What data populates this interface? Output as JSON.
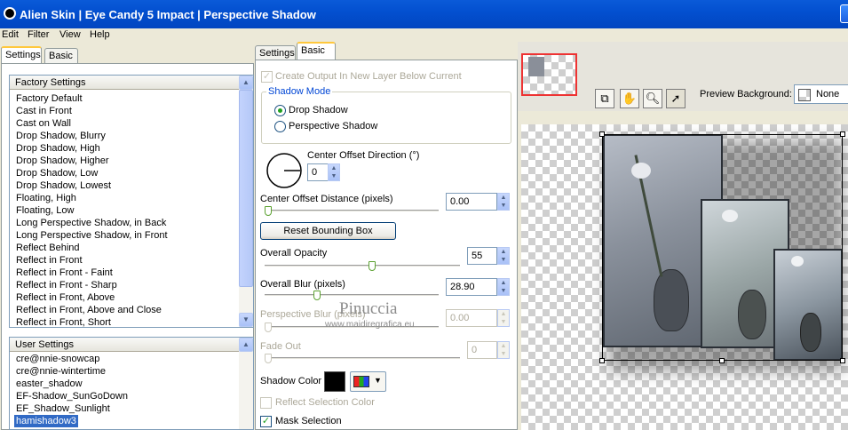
{
  "window": {
    "title": "Alien Skin  |  Eye Candy 5 Impact  |  Perspective Shadow"
  },
  "menu": [
    "Edit",
    "Filter",
    "View",
    "Help"
  ],
  "left_tabs": [
    "Settings",
    "Basic"
  ],
  "factory": {
    "header": "Factory Settings",
    "items": [
      "Factory Default",
      "Cast in Front",
      "Cast on Wall",
      "Drop Shadow, Blurry",
      "Drop Shadow, High",
      "Drop Shadow, Higher",
      "Drop Shadow, Low",
      "Drop Shadow, Lowest",
      "Floating, High",
      "Floating, Low",
      "Long Perspective Shadow, in Back",
      "Long Perspective Shadow, in Front",
      "Reflect Behind",
      "Reflect in Front",
      "Reflect in Front - Faint",
      "Reflect in Front - Sharp",
      "Reflect in Front, Above",
      "Reflect in Front, Above and Close",
      "Reflect in Front, Short"
    ]
  },
  "user": {
    "header": "User Settings",
    "items": [
      "cre@nnie-snowcap",
      "cre@nnie-wintertime",
      "easter_shadow",
      "EF-Shadow_SunGoDown",
      "EF_Shadow_Sunlight",
      "hamishadow3"
    ],
    "selected": 5
  },
  "mid_tabs": [
    "Settings",
    "Basic"
  ],
  "basic": {
    "create_output": "Create Output In New Layer Below Current",
    "shadow_mode_label": "Shadow Mode",
    "drop_shadow": "Drop Shadow",
    "perspective_shadow": "Perspective Shadow",
    "shadow_mode_selected": "Drop Shadow",
    "center_offset_direction_label": "Center Offset Direction (°)",
    "center_offset_direction_value": "0",
    "center_offset_distance_label": "Center Offset Distance (pixels)",
    "center_offset_distance_value": "0.00",
    "reset_bounding_box": "Reset Bounding Box",
    "overall_opacity_label": "Overall Opacity",
    "overall_opacity_value": "55",
    "overall_blur_label": "Overall Blur (pixels)",
    "overall_blur_value": "28.90",
    "perspective_blur_label": "Perspective Blur (pixels)",
    "perspective_blur_value": "0.00",
    "fade_out_label": "Fade Out",
    "fade_out_value": "0",
    "shadow_color_label": "Shadow Color",
    "shadow_color": "#000000",
    "reflect_selection_color": "Reflect Selection Color",
    "mask_selection": "Mask Selection"
  },
  "sliders": {
    "center_offset_distance": 0.0,
    "overall_opacity": 0.55,
    "overall_blur": 0.29,
    "perspective_blur": 0.0,
    "fade_out": 0.0
  },
  "preview": {
    "background_label": "Preview Background:",
    "background_value": "None"
  },
  "watermark": {
    "line1": "Pinuccia",
    "line2": "www.maidiregrafica.eu"
  },
  "colors": {
    "title_bar": "#0a5ad8",
    "selection": "#316ac5",
    "accent_green": "#21a121"
  }
}
